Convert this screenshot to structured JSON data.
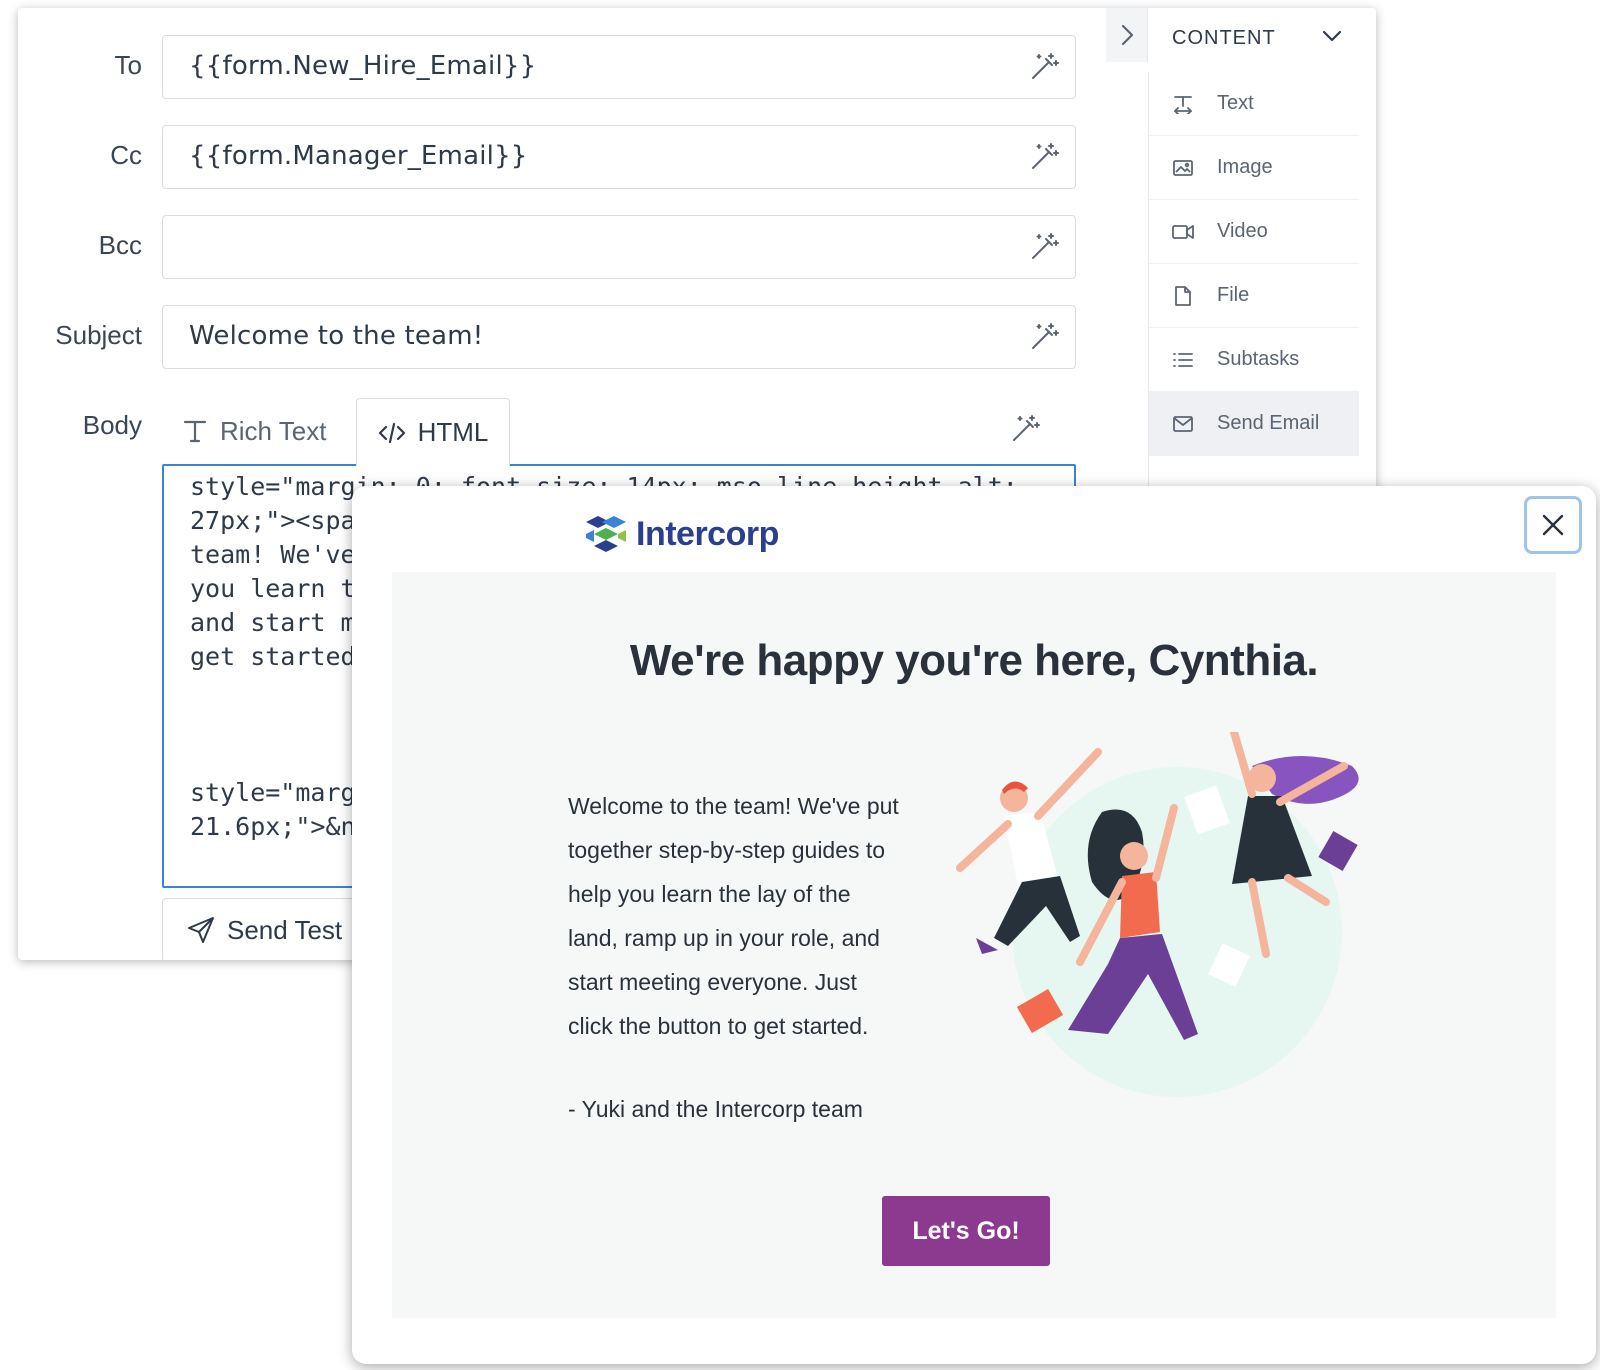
{
  "editor": {
    "fields": [
      {
        "label": "To",
        "value": "{{form.New_Hire_Email}}"
      },
      {
        "label": "Cc",
        "value": "{{form.Manager_Email}}"
      },
      {
        "label": "Bcc",
        "value": ""
      },
      {
        "label": "Subject",
        "value": "Welcome to the team!"
      }
    ],
    "body_label": "Body",
    "tabs": {
      "rich_text": "Rich Text",
      "html": "HTML",
      "active": "HTML"
    },
    "code_lines": [
      "style=\"margin: 0; font-size: 14px; mso-line-height-alt:",
      "27px;\"><spa",
      "team! We've",
      "you learn t",
      "and start m",
      "get started",
      "style=\"marg",
      "21.6px;\">&n"
    ],
    "send_test_label": "Send Test"
  },
  "side_panel": {
    "title": "CONTENT",
    "items": [
      {
        "label": "Text",
        "icon": "text-format-icon"
      },
      {
        "label": "Image",
        "icon": "image-icon"
      },
      {
        "label": "Video",
        "icon": "video-icon"
      },
      {
        "label": "File",
        "icon": "file-icon"
      },
      {
        "label": "Subtasks",
        "icon": "list-icon"
      },
      {
        "label": "Send Email",
        "icon": "envelope-icon",
        "active": true
      }
    ]
  },
  "preview": {
    "brand": "Intercorp",
    "headline": "We're happy you're here, Cynthia.",
    "paragraph_lines": [
      "Welcome to the team! We've put",
      "together step-by-step guides to",
      "help you learn the lay of the",
      "land, ramp up in your role, and",
      "start meeting everyone. Just",
      "click the button to get started."
    ],
    "signature": "- Yuki and the Intercorp team",
    "cta_label": "Let's Go!",
    "colors": {
      "cta": "#8b3a8f",
      "brand": "#2c3e8f",
      "focus": "#3b84d4"
    }
  }
}
